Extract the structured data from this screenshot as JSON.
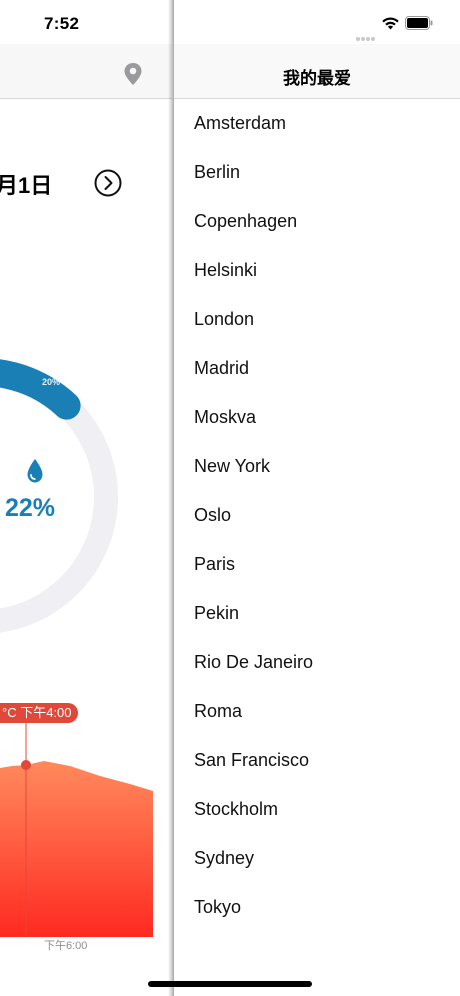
{
  "status_bar": {
    "time": "7:52"
  },
  "background_screen": {
    "date_fragment": "月1日",
    "humidity_value": "22%",
    "ring_percent_label": "20%",
    "ring_fill_fraction": 0.22,
    "tooltip": "°C 下午4:00",
    "x_axis_label": "下午6:00",
    "accent_color": "#1a7fb5",
    "chart_color": "#ff5a3c"
  },
  "favorites": {
    "title": "我的最爱",
    "cities": [
      "Amsterdam",
      "Berlin",
      "Copenhagen",
      "Helsinki",
      "London",
      "Madrid",
      "Moskva",
      "New York",
      "Oslo",
      "Paris",
      "Pekin",
      "Rio De Janeiro",
      "Roma",
      "San Francisco",
      "Stockholm",
      "Sydney",
      "Tokyo"
    ]
  }
}
